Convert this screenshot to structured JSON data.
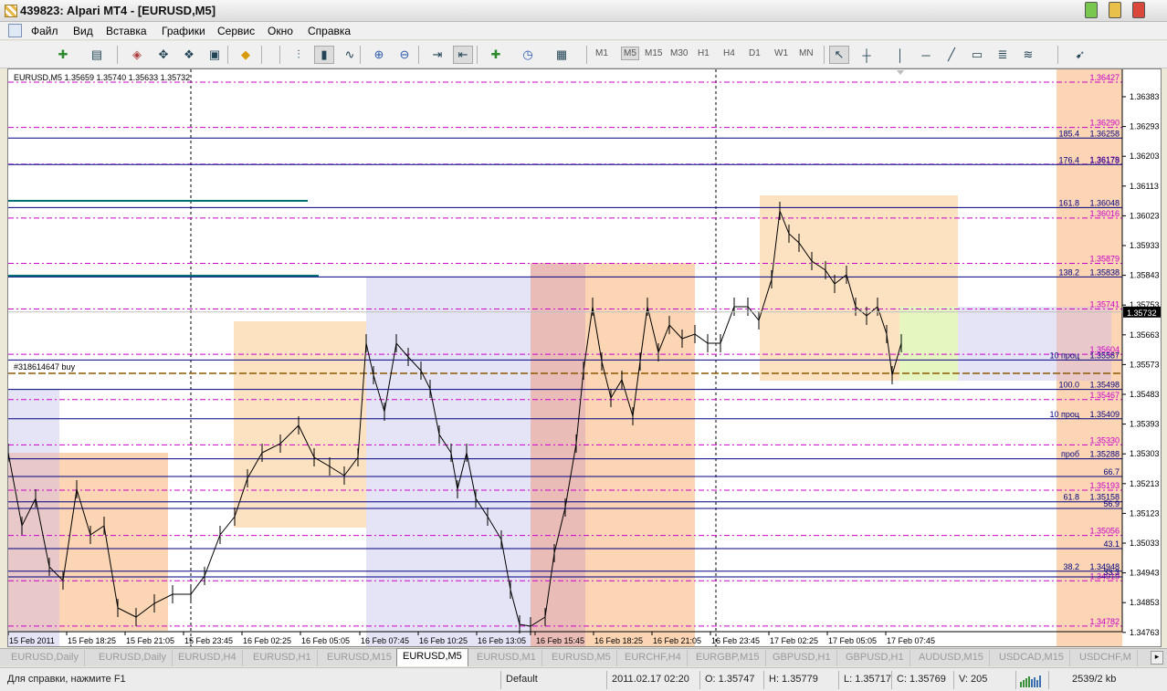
{
  "window": {
    "title": "439823: Alpari MT4 - [EURUSD,M5]"
  },
  "menu": [
    "Файл",
    "Вид",
    "Вставка",
    "Графики",
    "Сервис",
    "Окно",
    "Справка"
  ],
  "timeframes": [
    {
      "label": "M1",
      "active": false
    },
    {
      "label": "M5",
      "active": true
    },
    {
      "label": "M15",
      "active": false
    },
    {
      "label": "M30",
      "active": false
    },
    {
      "label": "H1",
      "active": false
    },
    {
      "label": "H4",
      "active": false
    },
    {
      "label": "D1",
      "active": false
    },
    {
      "label": "W1",
      "active": false
    },
    {
      "label": "MN",
      "active": false
    }
  ],
  "toolbar_icons": [
    "new-chart-icon",
    "profiles-icon",
    "market-watch-icon",
    "navigator-icon",
    "data-window-icon",
    "terminal-icon",
    "autotrading-icon",
    "bar-chart-icon",
    "candlestick-icon",
    "line-chart-icon",
    "zoom-in-icon",
    "zoom-out-icon",
    "autoscroll-icon",
    "chart-shift-icon",
    "indicators-icon",
    "periods-icon",
    "templates-icon",
    "cursor-icon",
    "crosshair-icon",
    "vertical-line-icon",
    "horizontal-line-icon",
    "trendline-icon",
    "rectangle-icon",
    "fibo-icon",
    "fibo-fan-icon",
    "arrows-icon"
  ],
  "chart": {
    "header": "EURUSD,M5  1.35659 1.35740 1.35633 1.35732",
    "order_label": "#318614647 buy",
    "price_ticks": [
      "1.36383",
      "1.36293",
      "1.36203",
      "1.36113",
      "1.36023",
      "1.35933",
      "1.35843",
      "1.35753",
      "1.35663",
      "1.35573",
      "1.35483",
      "1.35393",
      "1.35303",
      "1.35213",
      "1.35123",
      "1.35033",
      "1.34943",
      "1.34853",
      "1.34763"
    ],
    "current_price": "1.35732",
    "time_ticks": [
      "15 Feb 2011",
      "15 Feb 18:25",
      "15 Feb 21:05",
      "15 Feb 23:45",
      "16 Feb 02:25",
      "16 Feb 05:05",
      "16 Feb 07:45",
      "16 Feb 10:25",
      "16 Feb 13:05",
      "16 Feb 15:45",
      "16 Feb 18:25",
      "16 Feb 21:05",
      "16 Feb 23:45",
      "17 Feb 02:25",
      "17 Feb 05:05",
      "17 Feb 07:45"
    ],
    "pink_levels": [
      "1.36427",
      "1.36290",
      "1.36179",
      "1.36016",
      "1.35879",
      "1.35741",
      "1.35604",
      "1.35467",
      "1.35330",
      "1.35193",
      "1.35056",
      "1.34919",
      "1.34782"
    ],
    "fibo_levels": [
      {
        "ratio": "185.4",
        "price": "1.36258"
      },
      {
        "ratio": "176.4",
        "price": "1.36178"
      },
      {
        "ratio": "161.8",
        "price": "1.36048"
      },
      {
        "ratio": "138.2",
        "price": "1.35838"
      },
      {
        "ratio": "10  проц",
        "price": "1.35587"
      },
      {
        "ratio": "100.0",
        "price": "1.35498"
      },
      {
        "ratio": "10  проц",
        "price": "1.35409"
      },
      {
        "ratio": "проб",
        "price": "1.35288"
      },
      {
        "ratio": "61.8",
        "price": "1.35158"
      },
      {
        "ratio": "38.2",
        "price": "1.34948"
      }
    ],
    "extra_labels": [
      "66.7",
      "56.9",
      "43.1",
      "33.3"
    ]
  },
  "tabs": [
    {
      "label": "EURUSD,Daily",
      "active": false
    },
    {
      "label": "EURUSD,Daily",
      "active": false
    },
    {
      "label": "EURUSD,H4",
      "active": false
    },
    {
      "label": "EURUSD,H1",
      "active": false
    },
    {
      "label": "EURUSD,M15",
      "active": false
    },
    {
      "label": "EURUSD,M5",
      "active": true
    },
    {
      "label": "EURUSD,M1",
      "active": false
    },
    {
      "label": "EURUSD,M5",
      "active": false
    },
    {
      "label": "EURCHF,H4",
      "active": false
    },
    {
      "label": "EURGBP,M15",
      "active": false
    },
    {
      "label": "GBPUSD,H1",
      "active": false
    },
    {
      "label": "GBPUSD,H1",
      "active": false
    },
    {
      "label": "AUDUSD,M15",
      "active": false
    },
    {
      "label": "USDCAD,M15",
      "active": false
    },
    {
      "label": "USDCHF,M",
      "active": false
    }
  ],
  "status": {
    "help": "Для справки, нажмите F1",
    "profile": "Default",
    "datetime": "2011.02.17 02:20",
    "open": "O: 1.35747",
    "high": "H: 1.35779",
    "low": "L: 1.35717",
    "close": "C: 1.35769",
    "volume": "V: 205",
    "traffic": "2539/2 kb"
  },
  "colors": {
    "orange_zone": "#fde2c2",
    "peach_zone": "#fbd5b4",
    "lavender_zone": "#e4e4f6",
    "green_zone": "#e6f6c0",
    "fibo_line": "#000080",
    "level_line": "#cc00cc",
    "teal_line": "#007070"
  }
}
